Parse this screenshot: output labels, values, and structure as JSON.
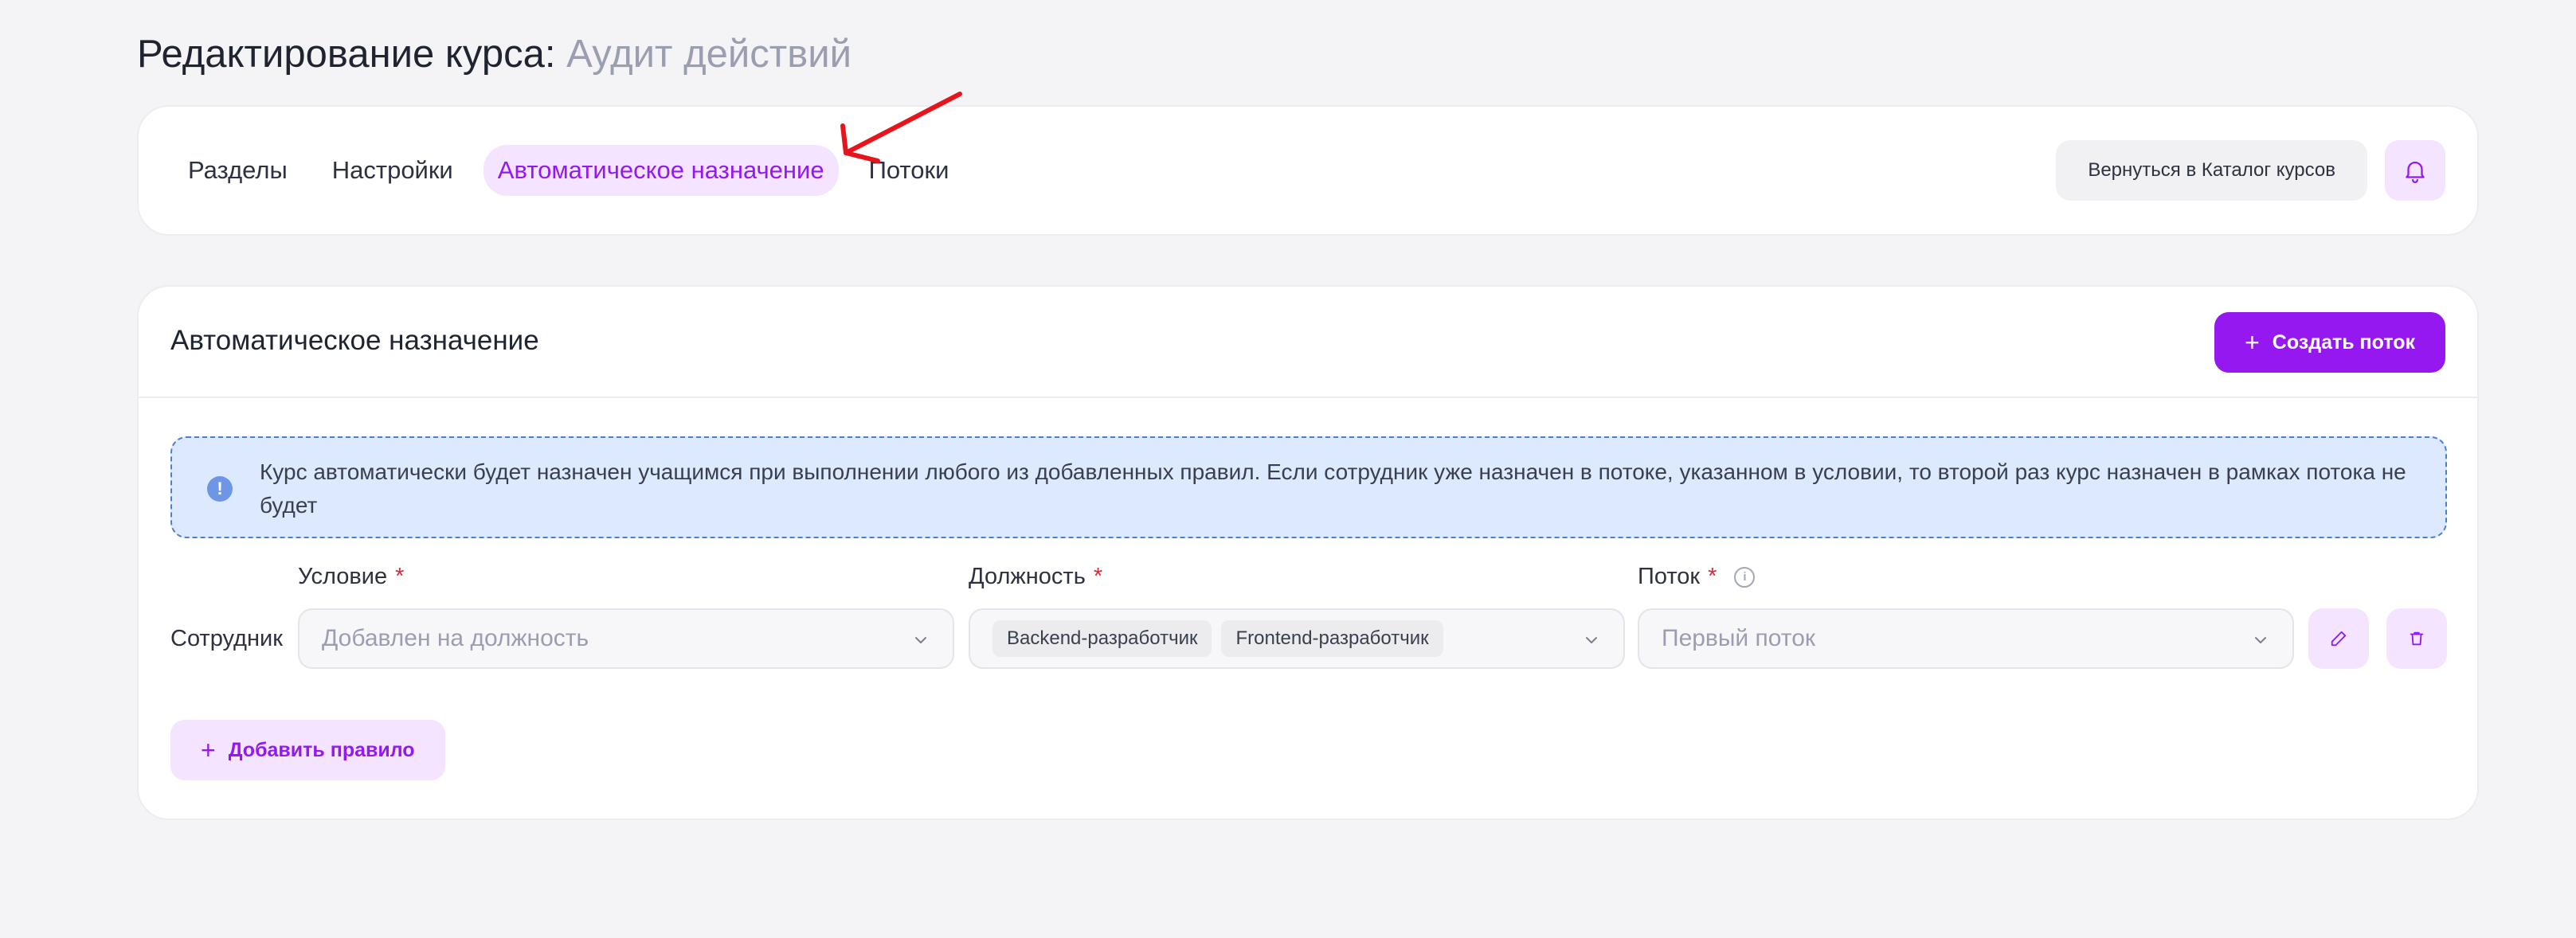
{
  "page": {
    "title_prefix": "Редактирование курса:",
    "course_name": "Аудит действий"
  },
  "top_nav": {
    "tabs": [
      {
        "label": "Разделы",
        "active": false
      },
      {
        "label": "Настройки",
        "active": false
      },
      {
        "label": "Автоматическое назначение",
        "active": true
      },
      {
        "label": "Потоки",
        "active": false
      }
    ],
    "back_button_label": "Вернуться в Каталог курсов",
    "bell_icon": "bell-icon"
  },
  "auto_assignment": {
    "title": "Автоматическое назначение",
    "create_button_label": "Создать поток",
    "info_text": "Курс автоматически будет назначен учащимся при выполнении любого из добавленных правил. Если сотрудник уже назначен в потоке, указанном в условии, то второй раз курс назначен в рамках потока не будет",
    "labels": {
      "condition": "Условие",
      "position": "Должность",
      "stream": "Поток",
      "required_mark": "*"
    },
    "rule": {
      "subject": "Сотрудник",
      "condition_value": "Добавлен на должность",
      "positions": [
        "Backend-разработчик",
        "Frontend-разработчик"
      ],
      "stream_value": "Первый поток"
    },
    "add_rule_label": "Добавить правило"
  },
  "colors": {
    "accent": "#9418ef",
    "accent_light": "#f4e4ff",
    "info_bg": "#dde9ff",
    "info_border": "#4d7fd0",
    "required": "#e0253a",
    "annotation_arrow": "#e8141c"
  }
}
